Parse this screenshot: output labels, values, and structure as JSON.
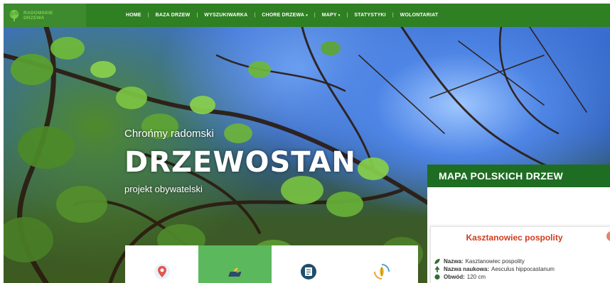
{
  "logo": {
    "line1": "RADOMSKIE",
    "line2": "DRZEWA"
  },
  "nav": {
    "items": [
      {
        "label": "HOME"
      },
      {
        "label": "BAZA DRZEW"
      },
      {
        "label": "WYSZUKIWARKA"
      },
      {
        "label": "CHORE DRZEWA",
        "caret": "▾"
      },
      {
        "label": "MAPY",
        "caret": "▾"
      },
      {
        "label": "STATYSTYKI"
      },
      {
        "label": "WOLONTARIAT"
      }
    ],
    "separator": "|"
  },
  "hero": {
    "tagline": "Chrońmy radomski",
    "title": "DRZEWOSTAN",
    "subtitle": "projekt obywatelski"
  },
  "tiles": [
    {
      "icon": "map-pin-icon",
      "active": false
    },
    {
      "icon": "tablet-leaf-icon",
      "active": true
    },
    {
      "icon": "notepad-icon",
      "active": false
    },
    {
      "icon": "leaf-cycle-icon",
      "active": false
    }
  ],
  "map": {
    "heading": "MAPA POLSKICH DRZEW",
    "popup": {
      "title": "Kasztanowiec pospolity",
      "close": "×",
      "rows": [
        {
          "icon": "leaf-icon",
          "label": "Nazwa:",
          "value": "Kasztanowiec pospolity"
        },
        {
          "icon": "tree-icon",
          "label": "Nazwa naukowa:",
          "value": "Aesculus hippocastanum"
        },
        {
          "icon": "circle-icon",
          "label": "Obwód:",
          "value": "120 cm"
        }
      ]
    }
  },
  "colors": {
    "nav": "#2f7f23",
    "accent": "#5cb85c",
    "map_header": "#1f6d22",
    "popup_title": "#d13b1c"
  }
}
